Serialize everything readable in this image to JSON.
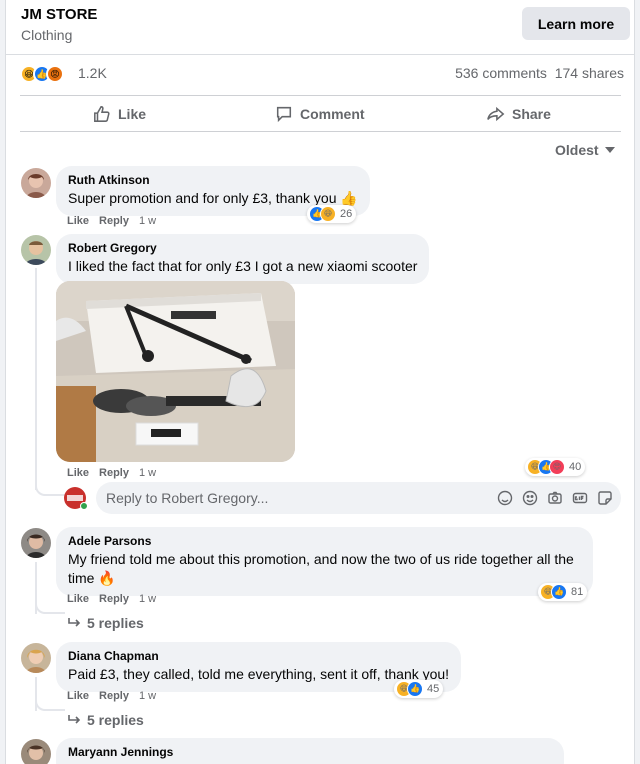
{
  "header": {
    "store_name": "JM STORE",
    "category": "Clothing",
    "cta_label": "Learn more"
  },
  "stats": {
    "reactions_total": "1.2K",
    "reaction_icons": [
      "haha",
      "like",
      "angry"
    ],
    "comments": "536 comments",
    "shares": "174 shares"
  },
  "actions": {
    "like": "Like",
    "comment": "Comment",
    "share": "Share"
  },
  "sort_label": "Oldest",
  "meta": {
    "like": "Like",
    "reply": "Reply"
  },
  "comments": [
    {
      "name": "Ruth Atkinson",
      "text": "Super promotion and for only £3, thank you 👍",
      "time": "1 w",
      "reactions": [
        "like",
        "haha"
      ],
      "count": "26"
    },
    {
      "name": "Robert Gregory",
      "text": "I liked the fact that for only £3 I got a new xiaomi scooter",
      "time": "1 w",
      "reactions": [
        "haha",
        "like",
        "love"
      ],
      "count": "40",
      "reply_placeholder": "Reply to Robert Gregory..."
    },
    {
      "name": "Adele Parsons",
      "text": "My friend told me about this promotion, and now the two of us ride together all the time 🔥",
      "time": "1 w",
      "reactions": [
        "haha",
        "like"
      ],
      "count": "81",
      "replies": "5 replies"
    },
    {
      "name": "Diana Chapman",
      "text": "Paid £3, they called, told me everything, sent it off, thank you!",
      "time": "1 w",
      "reactions": [
        "haha",
        "like"
      ],
      "count": "45",
      "replies": "5 replies"
    },
    {
      "name": "Maryann Jennings",
      "text": ""
    }
  ],
  "colors": {
    "text_secondary": "#65676b",
    "bubble_bg": "#f0f2f5",
    "like_blue": "#1877f2",
    "haha_yellow": "#f7b125",
    "angry_orange": "#e9710f"
  }
}
